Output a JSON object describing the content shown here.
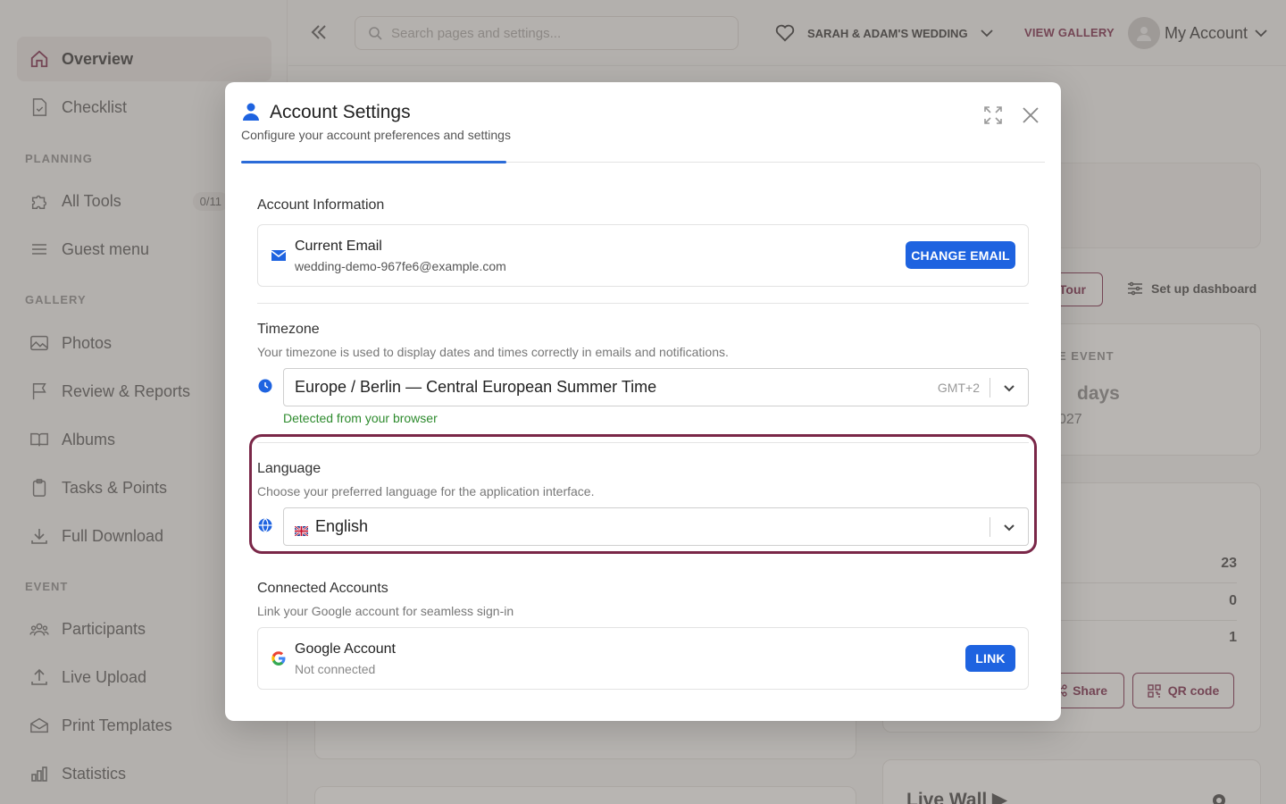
{
  "sidebar": {
    "items": [
      {
        "label": "Overview",
        "icon": "home-icon",
        "active": true
      },
      {
        "label": "Checklist",
        "icon": "checklist-icon"
      },
      {
        "label": "All Tools",
        "icon": "puzzle-icon",
        "count": "0/11"
      },
      {
        "label": "Guest menu",
        "icon": "menu-icon"
      },
      {
        "label": "Photos",
        "icon": "image-icon"
      },
      {
        "label": "Review & Reports",
        "icon": "flag-icon"
      },
      {
        "label": "Albums",
        "icon": "book-icon"
      },
      {
        "label": "Tasks & Points",
        "icon": "clipboard-icon"
      },
      {
        "label": "Full Download",
        "icon": "download-icon"
      },
      {
        "label": "Participants",
        "icon": "users-icon"
      },
      {
        "label": "Live Upload",
        "icon": "upload-icon"
      },
      {
        "label": "Print Templates",
        "icon": "envelope-icon"
      },
      {
        "label": "Statistics",
        "icon": "bar-chart-icon"
      }
    ],
    "sections": {
      "planning": "PLANNING",
      "gallery": "GALLERY",
      "event": "EVENT"
    }
  },
  "topbar": {
    "search_placeholder": "Search pages and settings...",
    "event_name": "SARAH & ADAM'S WEDDING",
    "view_gallery": "VIEW GALLERY",
    "account_label": "My Account"
  },
  "background": {
    "tour_btn": "Tour",
    "setup_dashboard": "Set up dashboard",
    "event_label": "E EVENT",
    "days_label": "days",
    "year_fragment": "027",
    "stat_1": "23",
    "stat_2": "0",
    "stat_3": "1",
    "share_btn": "Share",
    "qr_btn": "QR code",
    "live_wall": "Live Wall ▶"
  },
  "modal": {
    "title": "Account Settings",
    "subtitle": "Configure your account preferences and settings",
    "account_info": {
      "title": "Account Information",
      "email_label": "Current Email",
      "email_value": "wedding-demo-967fe6@example.com",
      "change_email_btn": "CHANGE EMAIL"
    },
    "timezone": {
      "title": "Timezone",
      "description": "Your timezone is used to display dates and times correctly in emails and notifications.",
      "selected": "Europe / Berlin — Central European Summer Time",
      "offset": "GMT+2",
      "detected": "Detected from your browser"
    },
    "language": {
      "title": "Language",
      "description": "Choose your preferred language for the application interface.",
      "selected": "English"
    },
    "connected": {
      "title": "Connected Accounts",
      "description": "Link your Google account for seamless sign-in",
      "google_label": "Google Account",
      "google_status": "Not connected",
      "link_btn": "LINK"
    }
  },
  "colors": {
    "accent": "#7a2748",
    "primary": "#1e63e0",
    "success": "#2e8b2e"
  }
}
